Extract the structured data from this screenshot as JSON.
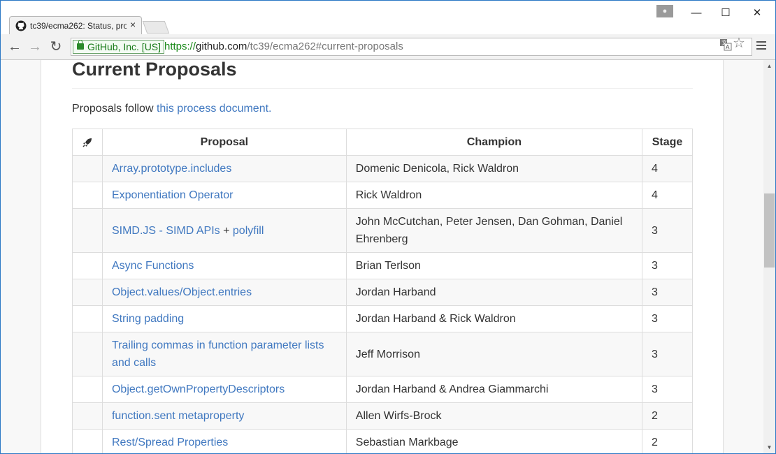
{
  "tab": {
    "title": "tc39/ecma262: Status, pro",
    "close": "×"
  },
  "window_controls": {
    "minimize": "—",
    "maximize": "☐",
    "close": "✕"
  },
  "toolbar": {
    "back": "←",
    "forward": "→",
    "reload": "↻",
    "star": "☆"
  },
  "address": {
    "ev_label": "GitHub, Inc. [US]",
    "scheme": "https://",
    "host": "github.com",
    "path": "/tc39/ecma262#current-proposals"
  },
  "page": {
    "heading": "Current Proposals",
    "intro_text": "Proposals follow ",
    "intro_link": "this process document."
  },
  "table": {
    "headers": [
      "Proposal",
      "Champion",
      "Stage"
    ],
    "rows": [
      {
        "proposal": "Array.prototype.includes",
        "champion": "Domenic Denicola, Rick Waldron",
        "stage": "4"
      },
      {
        "proposal": "Exponentiation Operator",
        "champion": "Rick Waldron",
        "stage": "4"
      },
      {
        "proposal": "SIMD.JS - SIMD APIs",
        "proposal_sep": " + ",
        "proposal_extra": "polyfill",
        "champion": "John McCutchan, Peter Jensen, Dan Gohman, Daniel Ehrenberg",
        "stage": "3"
      },
      {
        "proposal": "Async Functions",
        "champion": "Brian Terlson",
        "stage": "3"
      },
      {
        "proposal": "Object.values/Object.entries",
        "champion": "Jordan Harband",
        "stage": "3"
      },
      {
        "proposal": "String padding",
        "champion": "Jordan Harband & Rick Waldron",
        "stage": "3"
      },
      {
        "proposal": "Trailing commas in function parameter lists and calls",
        "champion": "Jeff Morrison",
        "stage": "3"
      },
      {
        "proposal": "Object.getOwnPropertyDescriptors",
        "champion": "Jordan Harband & Andrea Giammarchi",
        "stage": "3"
      },
      {
        "proposal": "function.sent metaproperty",
        "champion": "Allen Wirfs-Brock",
        "stage": "2"
      },
      {
        "proposal": "Rest/Spread Properties",
        "champion": "Sebastian Markbage",
        "stage": "2"
      }
    ]
  },
  "colors": {
    "link": "#4078c0",
    "ev_green": "#187a18",
    "window_border": "#2b78c5"
  }
}
